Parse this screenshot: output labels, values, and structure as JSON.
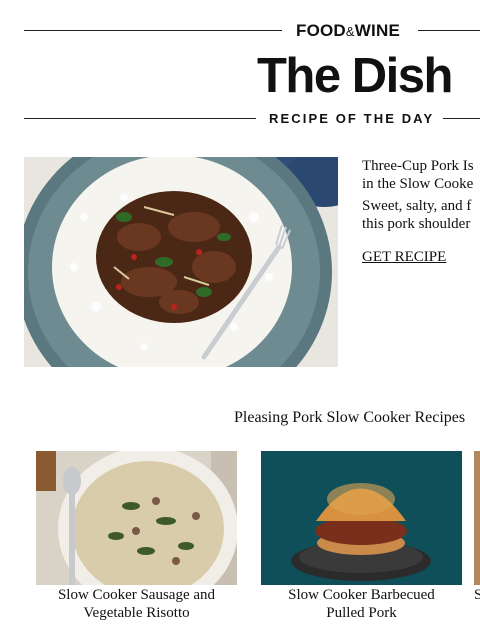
{
  "header": {
    "brand": "FOOD",
    "brand_amp": "&",
    "brand_end": "WINE",
    "title": "The Dish",
    "subtitle": "RECIPE OF THE DAY"
  },
  "feature": {
    "title_line1": "Three-Cup Pork Is",
    "title_line2": "in the Slow Cooke",
    "desc_line1": "Sweet, salty, and f",
    "desc_line2": "this pork shoulder",
    "link": "GET RECIPE"
  },
  "section": {
    "title": "Pleasing Pork Slow Cooker Recipes",
    "cards": [
      {
        "line1": "Slow Cooker Sausage and",
        "line2": "Vegetable Risotto"
      },
      {
        "line1": "Slow Cooker Barbecued",
        "line2": "Pulled Pork"
      },
      {
        "line1": "S",
        "line2": ""
      }
    ]
  }
}
